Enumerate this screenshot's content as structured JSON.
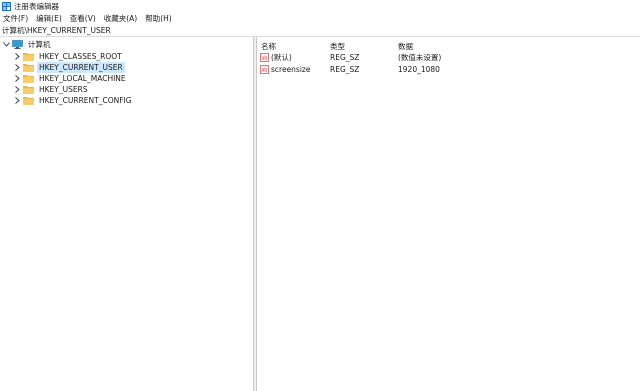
{
  "window": {
    "title": "注册表编辑器"
  },
  "menu": [
    {
      "label": "文件(F)"
    },
    {
      "label": "编辑(E)"
    },
    {
      "label": "查看(V)"
    },
    {
      "label": "收藏夹(A)"
    },
    {
      "label": "帮助(H)"
    }
  ],
  "address": {
    "path": "计算机\\HKEY_CURRENT_USER"
  },
  "tree": {
    "root": {
      "label": "计算机",
      "icon": "computer-icon"
    },
    "hives": [
      {
        "label": "HKEY_CLASSES_ROOT",
        "icon": "folder-icon",
        "selected": false
      },
      {
        "label": "HKEY_CURRENT_USER",
        "icon": "folder-icon",
        "selected": true
      },
      {
        "label": "HKEY_LOCAL_MACHINE",
        "icon": "folder-icon",
        "selected": false
      },
      {
        "label": "HKEY_USERS",
        "icon": "folder-icon",
        "selected": false
      },
      {
        "label": "HKEY_CURRENT_CONFIG",
        "icon": "folder-icon",
        "selected": false
      }
    ]
  },
  "values": {
    "columns": {
      "name": "名称",
      "type": "类型",
      "data": "数据"
    },
    "rows": [
      {
        "name": "(默认)",
        "type": "REG_SZ",
        "data": "(数值未设置)",
        "icon": "string-value-icon"
      },
      {
        "name": "screensize",
        "type": "REG_SZ",
        "data": "1920_1080",
        "icon": "string-value-icon"
      }
    ]
  },
  "colors": {
    "selection": "#cce8ff",
    "folder": "#e8b64a",
    "divider": "#c8c8c8"
  }
}
